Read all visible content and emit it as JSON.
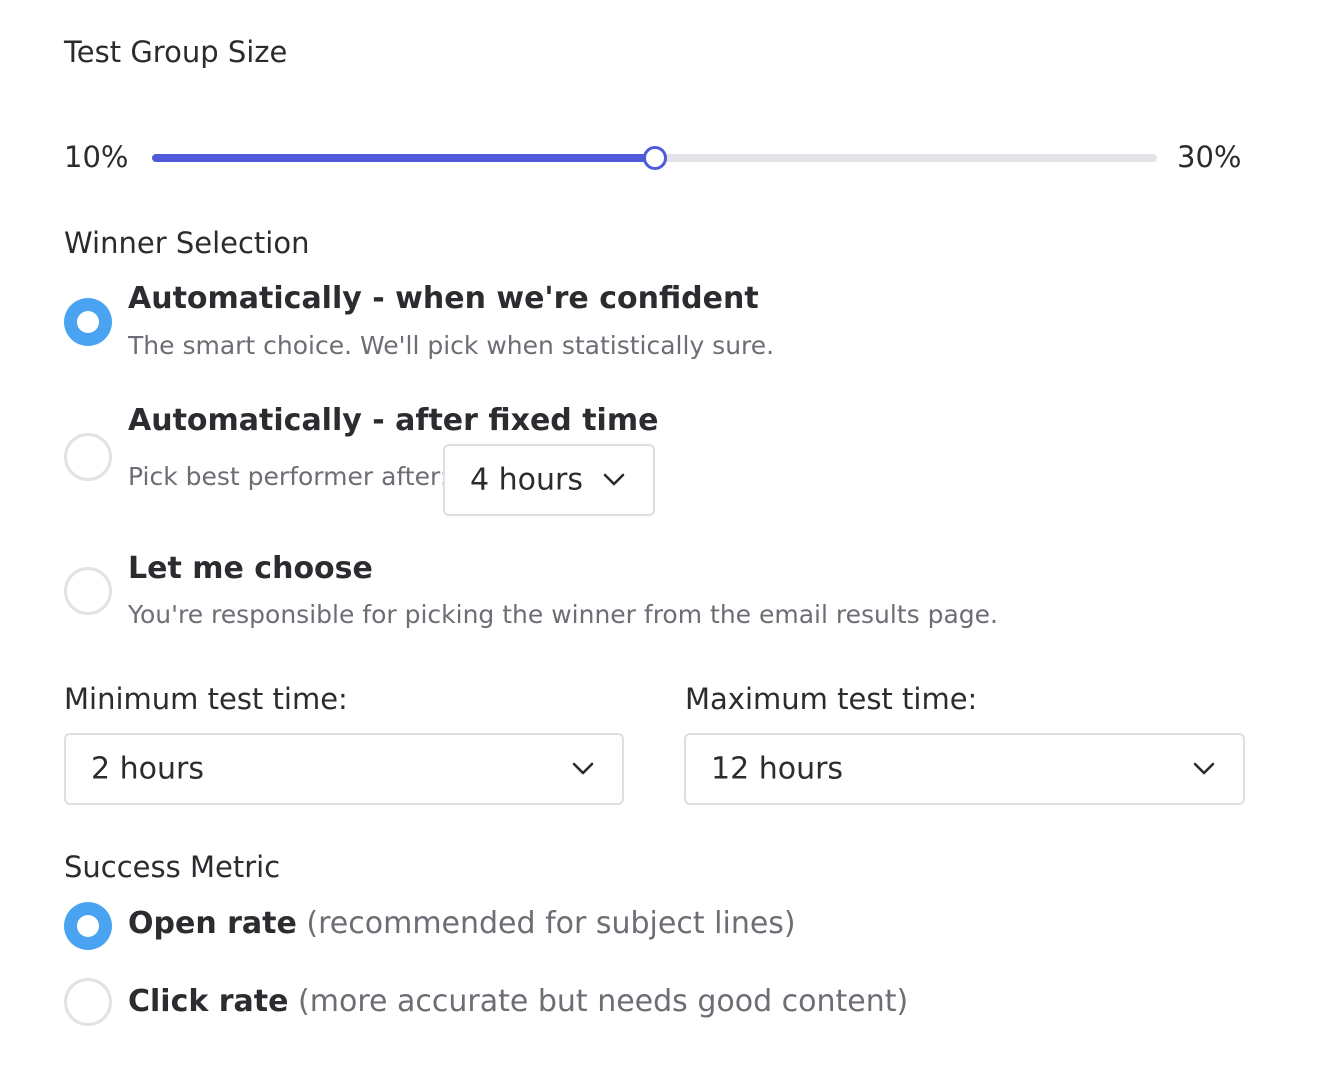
{
  "test_group_size": {
    "label": "Test Group Size",
    "min_label": "10%",
    "max_label": "30%",
    "value_fraction": 0.5
  },
  "winner_selection": {
    "label": "Winner Selection",
    "options": [
      {
        "title": "Automatically - when we're confident",
        "description": "The smart choice. We'll pick when statistically sure.",
        "selected": true
      },
      {
        "title": "Automatically - after fixed time",
        "description": "Pick best performer after:",
        "select_value": "4 hours",
        "selected": false
      },
      {
        "title": "Let me choose",
        "description": "You're responsible for picking the winner from the email results page.",
        "selected": false
      }
    ]
  },
  "test_time": {
    "min_label": "Minimum test time:",
    "min_value": "2 hours",
    "max_label": "Maximum test time:",
    "max_value": "12 hours"
  },
  "success_metric": {
    "label": "Success Metric",
    "options": [
      {
        "title": "Open rate",
        "note": "(recommended for subject lines)",
        "selected": true
      },
      {
        "title": "Click rate",
        "note": "(more accurate but needs good content)",
        "selected": false
      }
    ]
  },
  "colors": {
    "accent_slider": "#4f5bdb",
    "accent_radio": "#4aa3f0",
    "muted_text": "#6d6d75"
  },
  "icons": {
    "select_chevron": "chevron-down-icon"
  }
}
